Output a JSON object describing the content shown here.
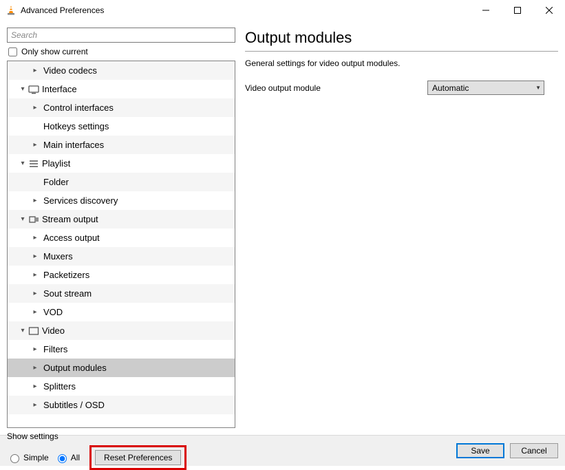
{
  "window": {
    "title": "Advanced Preferences"
  },
  "search": {
    "placeholder": "Search"
  },
  "only_current_label": "Only show current",
  "tree": [
    {
      "level": 1,
      "arrow": "right",
      "icon": null,
      "label": "Video codecs",
      "selected": false
    },
    {
      "level": 0,
      "arrow": "down",
      "icon": "interface",
      "label": "Interface",
      "selected": false
    },
    {
      "level": 1,
      "arrow": "right",
      "icon": null,
      "label": "Control interfaces",
      "selected": false
    },
    {
      "level": 1,
      "arrow": "blank",
      "icon": null,
      "label": "Hotkeys settings",
      "selected": false
    },
    {
      "level": 1,
      "arrow": "right",
      "icon": null,
      "label": "Main interfaces",
      "selected": false
    },
    {
      "level": 0,
      "arrow": "down",
      "icon": "playlist",
      "label": "Playlist",
      "selected": false
    },
    {
      "level": 1,
      "arrow": "blank",
      "icon": null,
      "label": "Folder",
      "selected": false
    },
    {
      "level": 1,
      "arrow": "right",
      "icon": null,
      "label": "Services discovery",
      "selected": false
    },
    {
      "level": 0,
      "arrow": "down",
      "icon": "stream",
      "label": "Stream output",
      "selected": false
    },
    {
      "level": 1,
      "arrow": "right",
      "icon": null,
      "label": "Access output",
      "selected": false
    },
    {
      "level": 1,
      "arrow": "right",
      "icon": null,
      "label": "Muxers",
      "selected": false
    },
    {
      "level": 1,
      "arrow": "right",
      "icon": null,
      "label": "Packetizers",
      "selected": false
    },
    {
      "level": 1,
      "arrow": "right",
      "icon": null,
      "label": "Sout stream",
      "selected": false
    },
    {
      "level": 1,
      "arrow": "right",
      "icon": null,
      "label": "VOD",
      "selected": false
    },
    {
      "level": 0,
      "arrow": "down",
      "icon": "video",
      "label": "Video",
      "selected": false
    },
    {
      "level": 1,
      "arrow": "right",
      "icon": null,
      "label": "Filters",
      "selected": false
    },
    {
      "level": 1,
      "arrow": "right",
      "icon": null,
      "label": "Output modules",
      "selected": true
    },
    {
      "level": 1,
      "arrow": "right",
      "icon": null,
      "label": "Splitters",
      "selected": false
    },
    {
      "level": 1,
      "arrow": "right",
      "icon": null,
      "label": "Subtitles / OSD",
      "selected": false
    }
  ],
  "panel": {
    "title": "Output modules",
    "description": "General settings for video output modules.",
    "field_label": "Video output module",
    "field_value": "Automatic"
  },
  "footer": {
    "show_settings_label": "Show settings",
    "radio_simple": "Simple",
    "radio_all": "All",
    "reset_label": "Reset Preferences",
    "save": "Save",
    "cancel": "Cancel"
  }
}
